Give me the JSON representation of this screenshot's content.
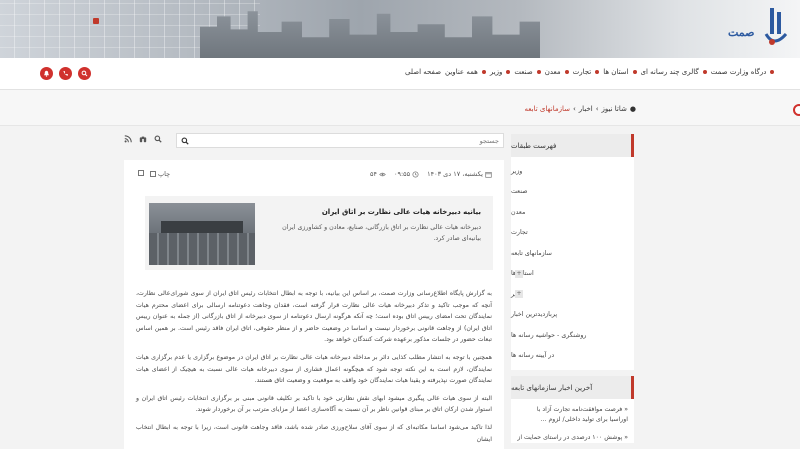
{
  "header": {
    "logo_text": "صمت"
  },
  "nav": {
    "items": [
      "صفحه اصلی",
      "همه عناوین",
      "وزیر",
      "صنعت",
      "معدن",
      "تجارت",
      "استان ها",
      "گالری چند رسانه ای",
      "درگاه وزارت صمت"
    ]
  },
  "breadcrumb": {
    "home": "شاتا نیوز",
    "section": "اخبار",
    "current": "سازمانهای تابعه"
  },
  "search": {
    "placeholder": "جستجو"
  },
  "article": {
    "date": "یکشنبه، ۱۷ دی ۱۴۰۳",
    "time": "۰۹:۵۵",
    "views": "۵۴",
    "print_label": "چاپ",
    "title": "بیانیه دبیرخانه هیات عالی نظارت بر اتاق ایران",
    "summary": "دبیرخانه هیات عالی نظارت بر اتاق بازرگانی، صنایع، معادن و کشاورزی ایران بیانیه‌ای صادر کرد.",
    "paragraphs": [
      "به گزارش پایگاه اطلاع‌رسانی وزارت صمت، بر اساس این بیانیه، با توجه به ابطال انتخابات رئیس اتاق ایران از سوی شورای‌عالی نظارت، آنچه که موجب تاکید و تذکر دبیرخانه هیات عالی نظارت قرار گرفته است، فقدان وجاهت دعوتنامه ارسالی برای اعضای محترم هیات نمایندگان تحت امضای رییس اتاق بوده است؛ چه آنکه هرگونه ارسال دعوتنامه از سوی دبیرخانه از اتاق بازرگانی (از جمله به عنوان رییس اتاق ایران) از وجاهت قانونی برخوردار نیست و اساسا در وضعیت حاضر و از منظر حقوقی، اتاق ایران فاقد رئیس است. بر همین اساس تبعات حضور در جلسات مذکور برعهده شرکت کنندگان خواهد بود.",
      "همچنین با توجه به انتشار مطلب کذایی دائر بر مداخله دبیرخانه هیات عالی نظارت بر اتاق ایران در موضوع برگزاری یا عدم برگزاری هیات نمایندگان، لازم است به این نکته توجه شود که هیچگونه اعمال فشاری از سوی دبیرخانه هیات عالی نسبت به هیچیک از اعضای هیات نمایندگان صورت نپذیرفته و یقینا هیات نمایندگان خود واقف به موقعیت و وضعیت اتاق هستند.",
      "البته از سوی هیات عالی پیگیری میشود ابهای نقش نظارتی خود با تاکید بر تکلیف قانونی مبنی بر برگزاری انتخابات رئیس اتاق ایران و استوار شدن ارکان اتاق بر مبنای قوانین ناظر بر آن نسبت به آگاه‌سازی اعضا از مزایای مترتب بر آن برخوردار شوند.",
      "لذا تاکید می‌شود اساسا مکاتبه‌ای که از سوی آقای سلاح‌ورزی صادر شده باشد، فاقد وجاهت قانونی است، زیرا با توجه به ابطال انتخاب ایشان"
    ]
  },
  "sidebar": {
    "categories_title": "فهرست طبقات",
    "categories": [
      {
        "label": "وزیر",
        "expandable": false
      },
      {
        "label": "صنعت",
        "expandable": false
      },
      {
        "label": "معدن",
        "expandable": false
      },
      {
        "label": "تجارت",
        "expandable": false
      },
      {
        "label": "سازمانهای تابعه",
        "expandable": false
      },
      {
        "label": "استان ها",
        "expandable": true
      },
      {
        "label": "سایر",
        "expandable": true
      },
      {
        "label": "پربازدیدترین اخبار",
        "expandable": false
      },
      {
        "label": "روشنگری - حواشیه رسانه ها",
        "expandable": false
      },
      {
        "label": "در آیینه رسانه ها",
        "expandable": false
      }
    ],
    "latest_title": "آخرین اخبار سازمانهای تابعه",
    "latest": [
      "« فرصت موافقت‌نامه تجارت آزاد با اوراسیا برای تولید داخلی/ لزوم ...",
      "« پوشش ۱۰۰ درصدی در راستای حمایت از"
    ]
  },
  "colors": {
    "accent": "#c0392b",
    "icon_red": "#d0312d"
  }
}
